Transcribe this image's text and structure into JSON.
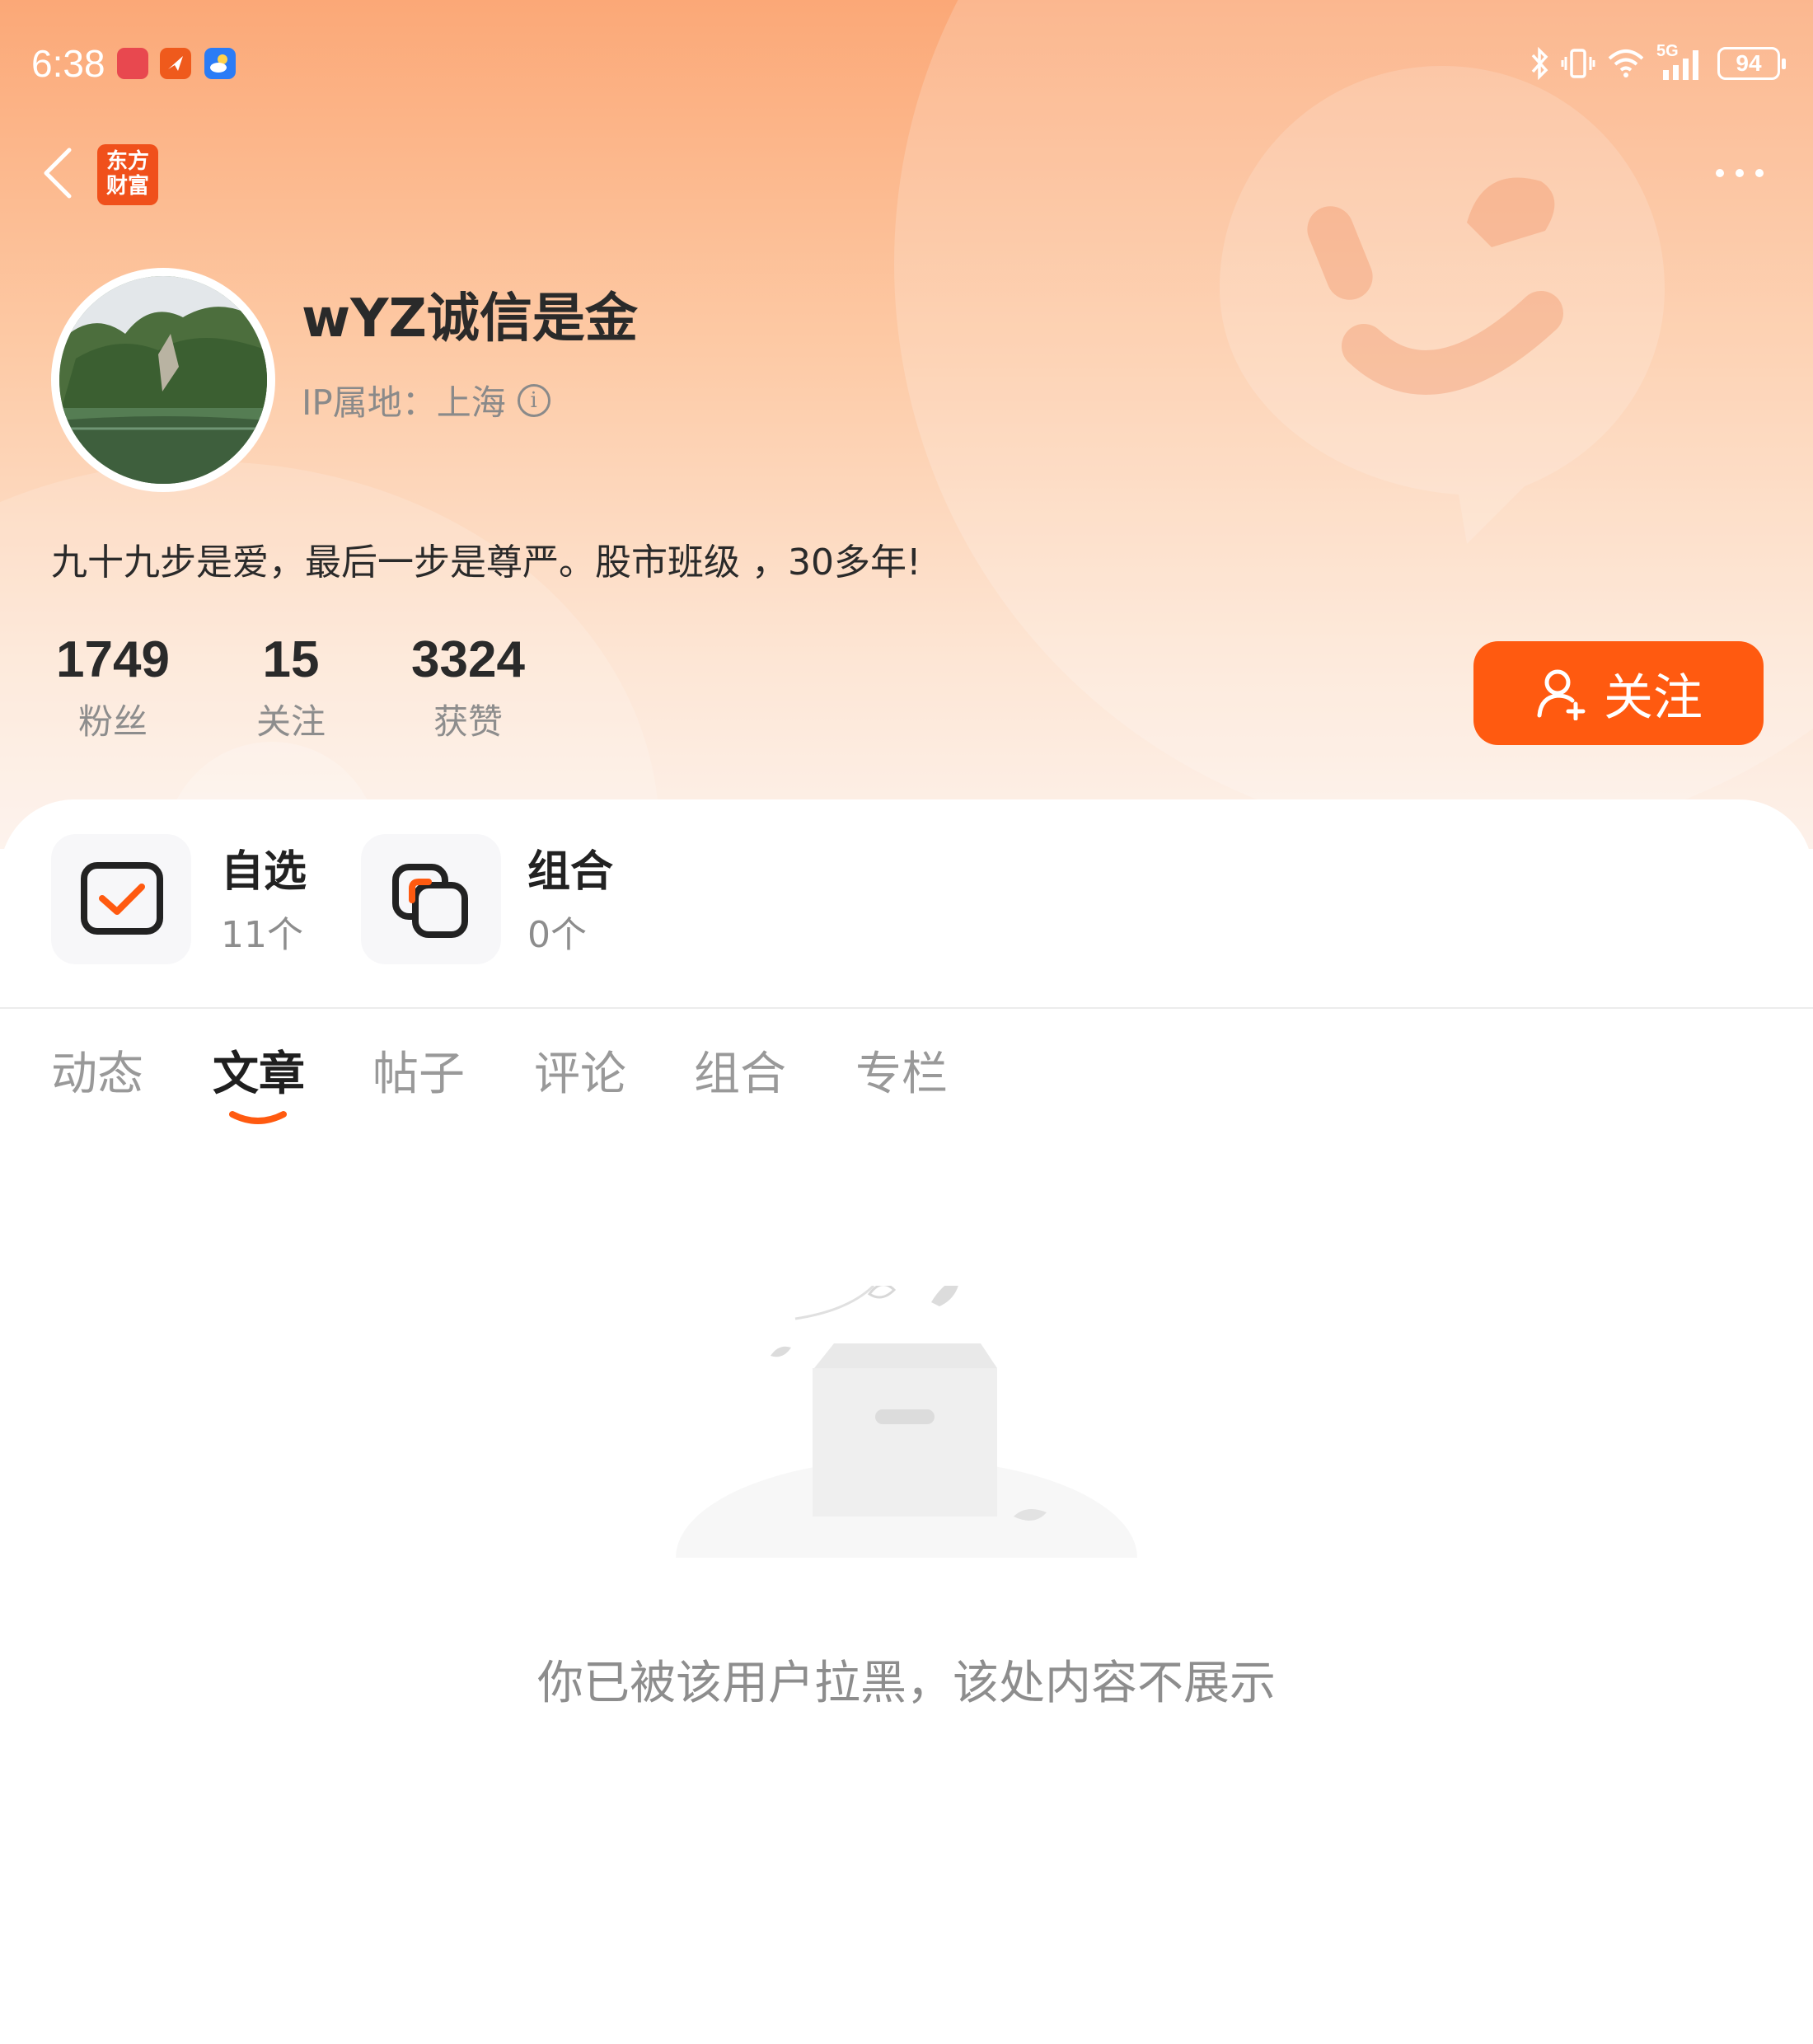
{
  "status_bar": {
    "time": "6:38",
    "network": "5G",
    "battery": "94"
  },
  "nav": {
    "brand_logo_line1": "东方",
    "brand_logo_line2": "财富"
  },
  "profile": {
    "username": "wYZ诚信是金",
    "ip_location": "IP属地：上海",
    "bio": "九十九步是爱，最后一步是尊严。股市班级 ，30多年!",
    "stats": [
      {
        "value": "1749",
        "label": "粉丝"
      },
      {
        "value": "15",
        "label": "关注"
      },
      {
        "value": "3324",
        "label": "获赞"
      }
    ],
    "follow_button_label": "关注"
  },
  "shortcuts": [
    {
      "title": "自选",
      "count": "11个"
    },
    {
      "title": "组合",
      "count": "0个"
    }
  ],
  "tabs": [
    {
      "label": "动态",
      "active": false
    },
    {
      "label": "文章",
      "active": true
    },
    {
      "label": "帖子",
      "active": false
    },
    {
      "label": "评论",
      "active": false
    },
    {
      "label": "组合",
      "active": false
    },
    {
      "label": "专栏",
      "active": false
    }
  ],
  "empty_state": {
    "message": "你已被该用户拉黑，该处内容不展示"
  },
  "colors": {
    "accent": "#ff5a10",
    "header_gradient_top": "#fba877",
    "header_gradient_bottom": "#fdf1ea"
  }
}
